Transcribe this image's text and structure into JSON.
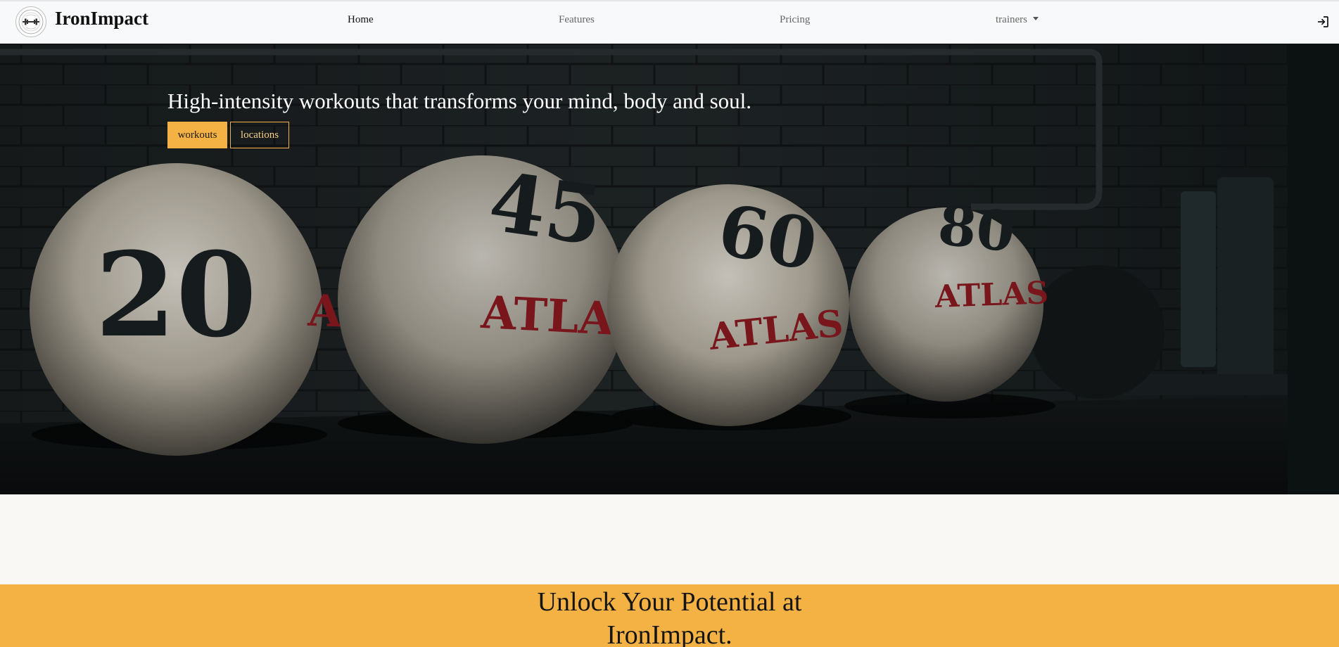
{
  "brand": {
    "name": "IronImpact",
    "logo_icon": "barbell-emblem-icon"
  },
  "nav": {
    "items": [
      {
        "label": "Home",
        "active": true
      },
      {
        "label": "Features",
        "active": false
      },
      {
        "label": "Pricing",
        "active": false
      },
      {
        "label": "trainers",
        "active": false,
        "dropdown": true
      }
    ],
    "login_icon": "sign-in-icon"
  },
  "hero": {
    "headline": "High-intensity workouts that transforms your mind, body and soul.",
    "buttons": {
      "workouts": "workouts",
      "locations": "locations"
    },
    "image": {
      "balls": [
        {
          "number": "20",
          "brand": "ARTAN"
        },
        {
          "number": "45",
          "brand": "ATLAS"
        },
        {
          "number": "60",
          "brand": "ATLAS"
        },
        {
          "number": "80",
          "brand": "ATLAS"
        }
      ]
    }
  },
  "cta": {
    "line1": "Unlock Your Potential at",
    "line2": "IronImpact."
  },
  "colors": {
    "accent": "#f5b244",
    "navbar_bg": "#f8f9fa",
    "page_bg": "#faf8f5"
  }
}
